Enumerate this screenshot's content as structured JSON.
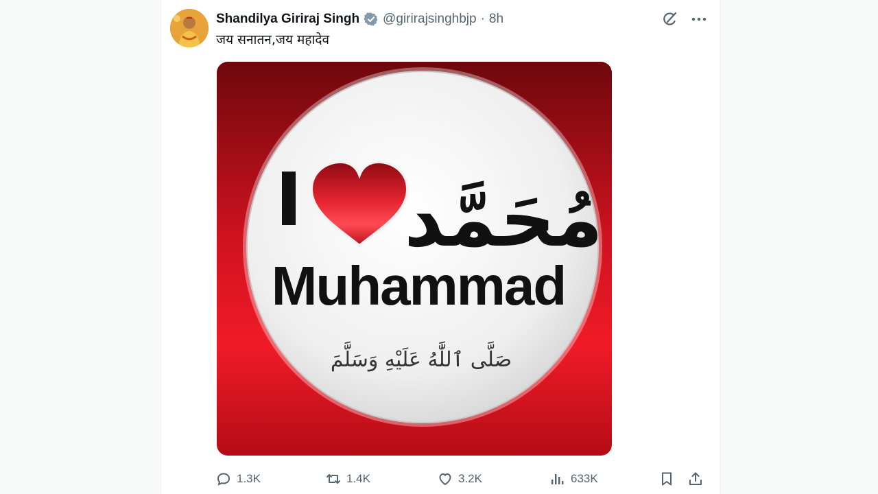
{
  "tweet": {
    "author_name": "Shandilya Giriraj Singh",
    "verified_icon": "verified-badge-icon",
    "handle": "@girirajsinghbjp",
    "separator": "·",
    "time": "8h",
    "text": "जय सनातन,जय महादेव",
    "top_actions": [
      "grok-icon",
      "more-icon"
    ]
  },
  "media": {
    "caption_letter": "I",
    "name_arabic": "مُحَمَّد",
    "name_latin": "Muhammad",
    "honorific_arabic": "صَلَّى ٱللَّٰهُ عَلَيْهِ وَسَلَّمَ",
    "colors": {
      "ring_red": "#d8101e",
      "dark_red": "#7d0a10",
      "disc": "#f4f4f4",
      "heart": "#d41422"
    }
  },
  "actions": {
    "replies": "1.3K",
    "reposts": "1.4K",
    "likes": "3.2K",
    "views": "633K",
    "icons": [
      "reply-icon",
      "repost-icon",
      "like-icon",
      "views-icon",
      "bookmark-icon",
      "share-icon"
    ]
  }
}
